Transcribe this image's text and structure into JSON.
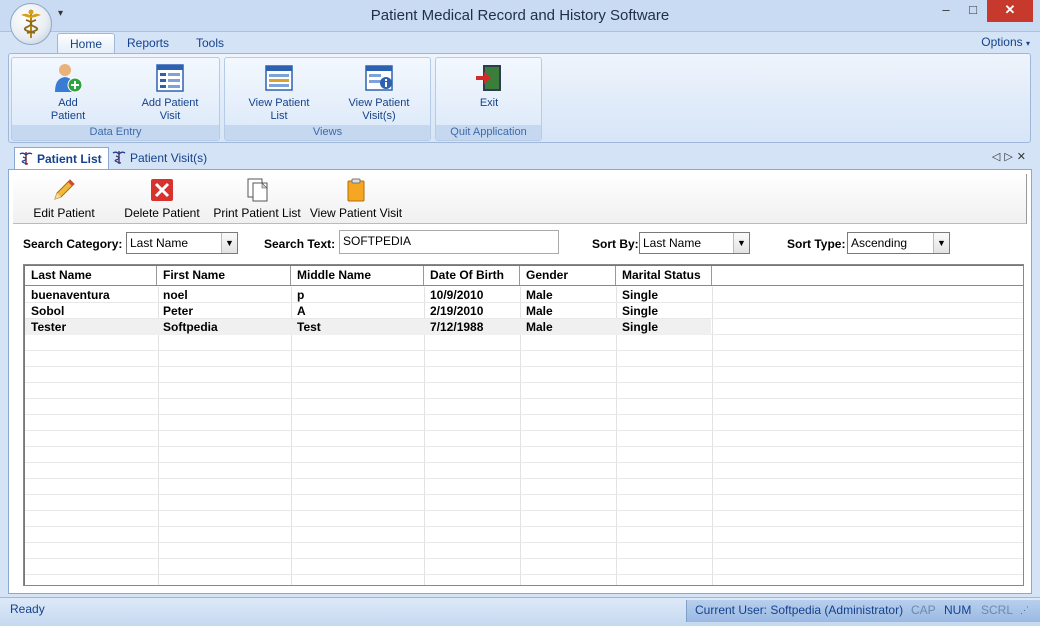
{
  "window": {
    "title": "Patient Medical Record and History Software",
    "qat_glyph": "▾",
    "min_glyph": "‒",
    "max_glyph": "□",
    "close_glyph": "✕"
  },
  "ribbon": {
    "tabs": [
      {
        "label": "Home"
      },
      {
        "label": "Reports"
      },
      {
        "label": "Tools"
      }
    ],
    "options_label": "Options",
    "groups": {
      "data_entry": {
        "label": "Data Entry",
        "add_patient": "Add\nPatient",
        "add_patient_visit": "Add Patient\nVisit"
      },
      "views": {
        "label": "Views",
        "view_patient_list": "View Patient\nList",
        "view_patient_visits": "View Patient\nVisit(s)"
      },
      "quit": {
        "label": "Quit Application",
        "exit": "Exit"
      }
    }
  },
  "doc_tabs": {
    "patient_list": "Patient List",
    "patient_visits": "Patient Visit(s)",
    "nav_glyphs": "◁▷✕"
  },
  "toolbar": {
    "edit_patient": "Edit Patient",
    "delete_patient": "Delete Patient",
    "print_patient_list": "Print Patient List",
    "view_patient_visit": "View Patient Visit"
  },
  "search": {
    "category_label": "Search Category:",
    "category_value": "Last Name",
    "text_label": "Search Text:",
    "text_value": "SOFTPEDIA",
    "sort_by_label": "Sort By:",
    "sort_by_value": "Last Name",
    "sort_type_label": "Sort Type:",
    "sort_type_value": "Ascending"
  },
  "table": {
    "columns": [
      "Last Name",
      "First Name",
      "Middle Name",
      "Date Of Birth",
      "Gender",
      "Marital Status"
    ],
    "rows": [
      [
        "buenaventura",
        "noel",
        "p",
        "10/9/2010",
        "Male",
        "Single"
      ],
      [
        "Sobol",
        "Peter",
        "A",
        "2/19/2010",
        "Male",
        "Single"
      ],
      [
        "Tester",
        "Softpedia",
        "Test",
        "7/12/1988",
        "Male",
        "Single"
      ]
    ]
  },
  "status": {
    "ready": "Ready",
    "current_user": "Current User: Softpedia (Administrator)",
    "cap": "CAP",
    "num": "NUM",
    "scrl": "SCRL"
  }
}
